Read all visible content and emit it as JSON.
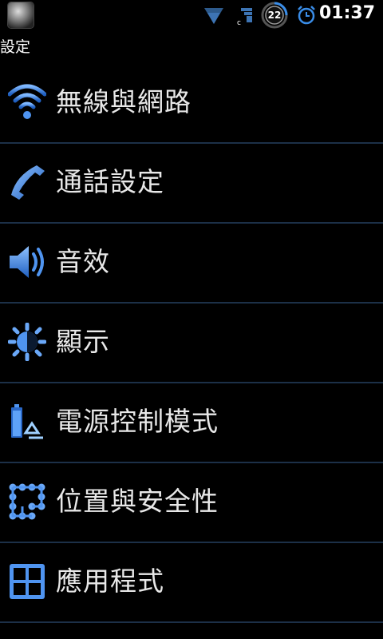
{
  "status_bar": {
    "time": "01:37",
    "battery_level": "22",
    "icons": [
      "app-icon",
      "wifi-icon",
      "signal-icon",
      "battery-icon",
      "alarm-icon"
    ],
    "signal_label": "c"
  },
  "header": {
    "title": "設定"
  },
  "settings": {
    "items": [
      {
        "label": "無線與網路",
        "icon": "wifi-icon"
      },
      {
        "label": "通話設定",
        "icon": "phone-icon"
      },
      {
        "label": "音效",
        "icon": "speaker-icon"
      },
      {
        "label": "顯示",
        "icon": "brightness-icon"
      },
      {
        "label": "電源控制模式",
        "icon": "battery-recycle-icon"
      },
      {
        "label": "位置與安全性",
        "icon": "location-security-icon"
      },
      {
        "label": "應用程式",
        "icon": "applications-icon"
      }
    ]
  },
  "colors": {
    "accent": "#3a8de8",
    "divider": "#1c3048",
    "background": "#000000"
  }
}
